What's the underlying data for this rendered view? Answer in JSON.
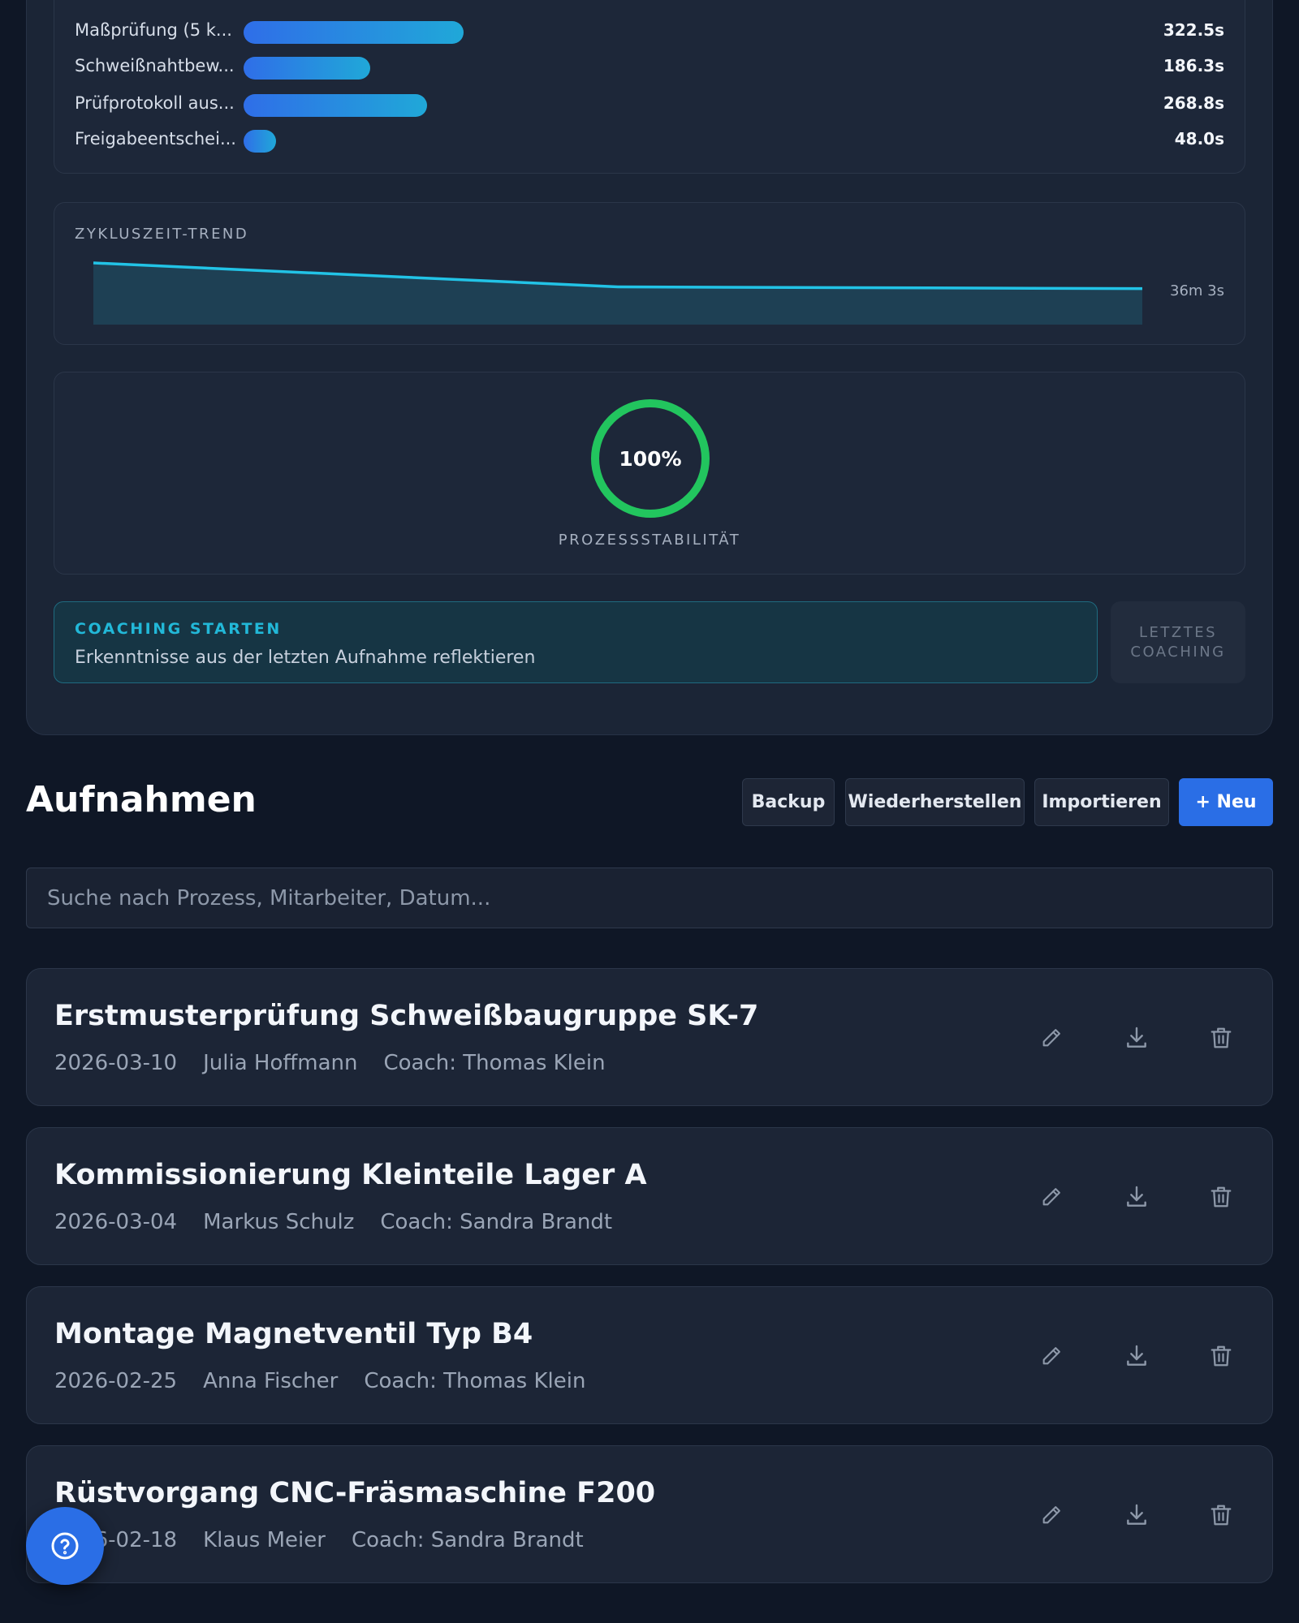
{
  "analysis": {
    "steps": [
      {
        "label": "Maßprüfung (5 k...",
        "value": 322.5,
        "display": "322.5s"
      },
      {
        "label": "Schweißnahtbew...",
        "value": 186.3,
        "display": "186.3s"
      },
      {
        "label": "Prüfprotokoll aus...",
        "value": 268.8,
        "display": "268.8s"
      },
      {
        "label": "Freigabeentschei...",
        "value": 48.0,
        "display": "48.0s"
      }
    ],
    "trend": {
      "title": "ZYKLUSZEIT-TREND",
      "last_value": "36m 3s",
      "points": [
        1.0,
        0.59,
        0.58,
        0.56
      ]
    },
    "stability": {
      "percent": 100,
      "display": "100%",
      "label": "PROZESSSTABILITÄT",
      "color": "#22c55e"
    },
    "coaching": {
      "start_title": "COACHING STARTEN",
      "start_subtitle": "Erkenntnisse aus der letzten Aufnahme reflektieren",
      "last_label": "LETZTES COACHING"
    }
  },
  "recordings": {
    "title": "Aufnahmen",
    "buttons": {
      "backup": "Backup",
      "restore": "Wiederherstellen",
      "import": "Importieren",
      "new": "+ Neu"
    },
    "search_placeholder": "Suche nach Prozess, Mitarbeiter, Datum...",
    "items": [
      {
        "title": "Erstmusterprüfung Schweißbaugruppe SK-7",
        "date": "2026-03-10",
        "employee": "Julia Hoffmann",
        "coach": "Coach: Thomas Klein"
      },
      {
        "title": "Kommissionierung Kleinteile Lager A",
        "date": "2026-03-04",
        "employee": "Markus Schulz",
        "coach": "Coach: Sandra Brandt"
      },
      {
        "title": "Montage Magnetventil Typ B4",
        "date": "2026-02-25",
        "employee": "Anna Fischer",
        "coach": "Coach: Thomas Klein"
      },
      {
        "title": "Rüstvorgang CNC-Fräsmaschine F200",
        "date": "2026-02-18",
        "employee": "Klaus Meier",
        "coach": "Coach: Sandra Brandt"
      }
    ],
    "item_icons": [
      "pencil-icon",
      "download-icon",
      "trash-icon"
    ]
  },
  "help_icon": "question-circle-icon"
}
